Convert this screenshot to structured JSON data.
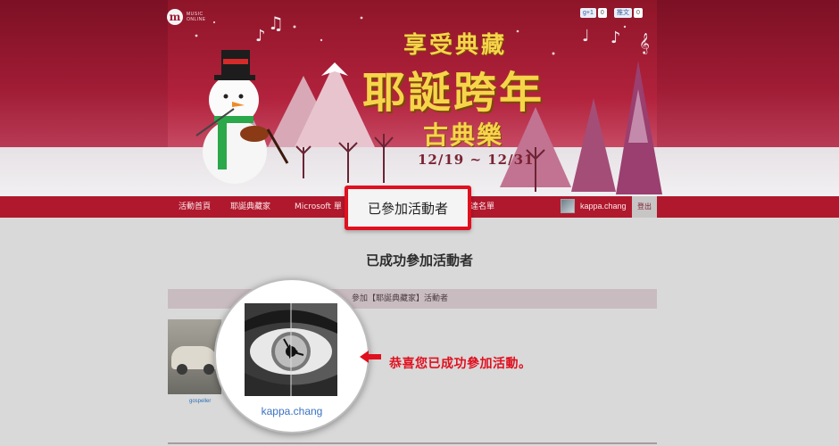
{
  "banner": {
    "logo_mark": "m",
    "logo_text_line1": "MUSIC",
    "logo_text_line2": "ONLINE",
    "share_plus_label": "g+1",
    "share_plus_count": "0",
    "share_twitter_label": "推文",
    "share_twitter_count": "0",
    "title_line1": "享受典藏",
    "title_line2": "耶誕跨年",
    "title_line3": "古典樂",
    "date_range": "12/19 ~ 12/31"
  },
  "nav": {
    "items": [
      {
        "label": "活動首頁"
      },
      {
        "label": "耶誕典藏家"
      },
      {
        "label": "Microsoft 單"
      },
      {
        "label": "達名單"
      }
    ],
    "username": "kappa.chang",
    "logout_label": "登出",
    "highlighted_tab": "已參加活動者"
  },
  "content": {
    "section_title": "已成功參加活動者",
    "sub_bar_text": "參加【耶誕典藏家】活動者",
    "member_name": "gospeller",
    "zoom_username": "kappa.chang",
    "congrats_text": "恭喜您已成功參加活動。"
  },
  "colors": {
    "brand_red": "#b0192d",
    "callout_red": "#e0101f",
    "link_blue": "#3a72c2",
    "title_gold": "#f6d54a"
  }
}
